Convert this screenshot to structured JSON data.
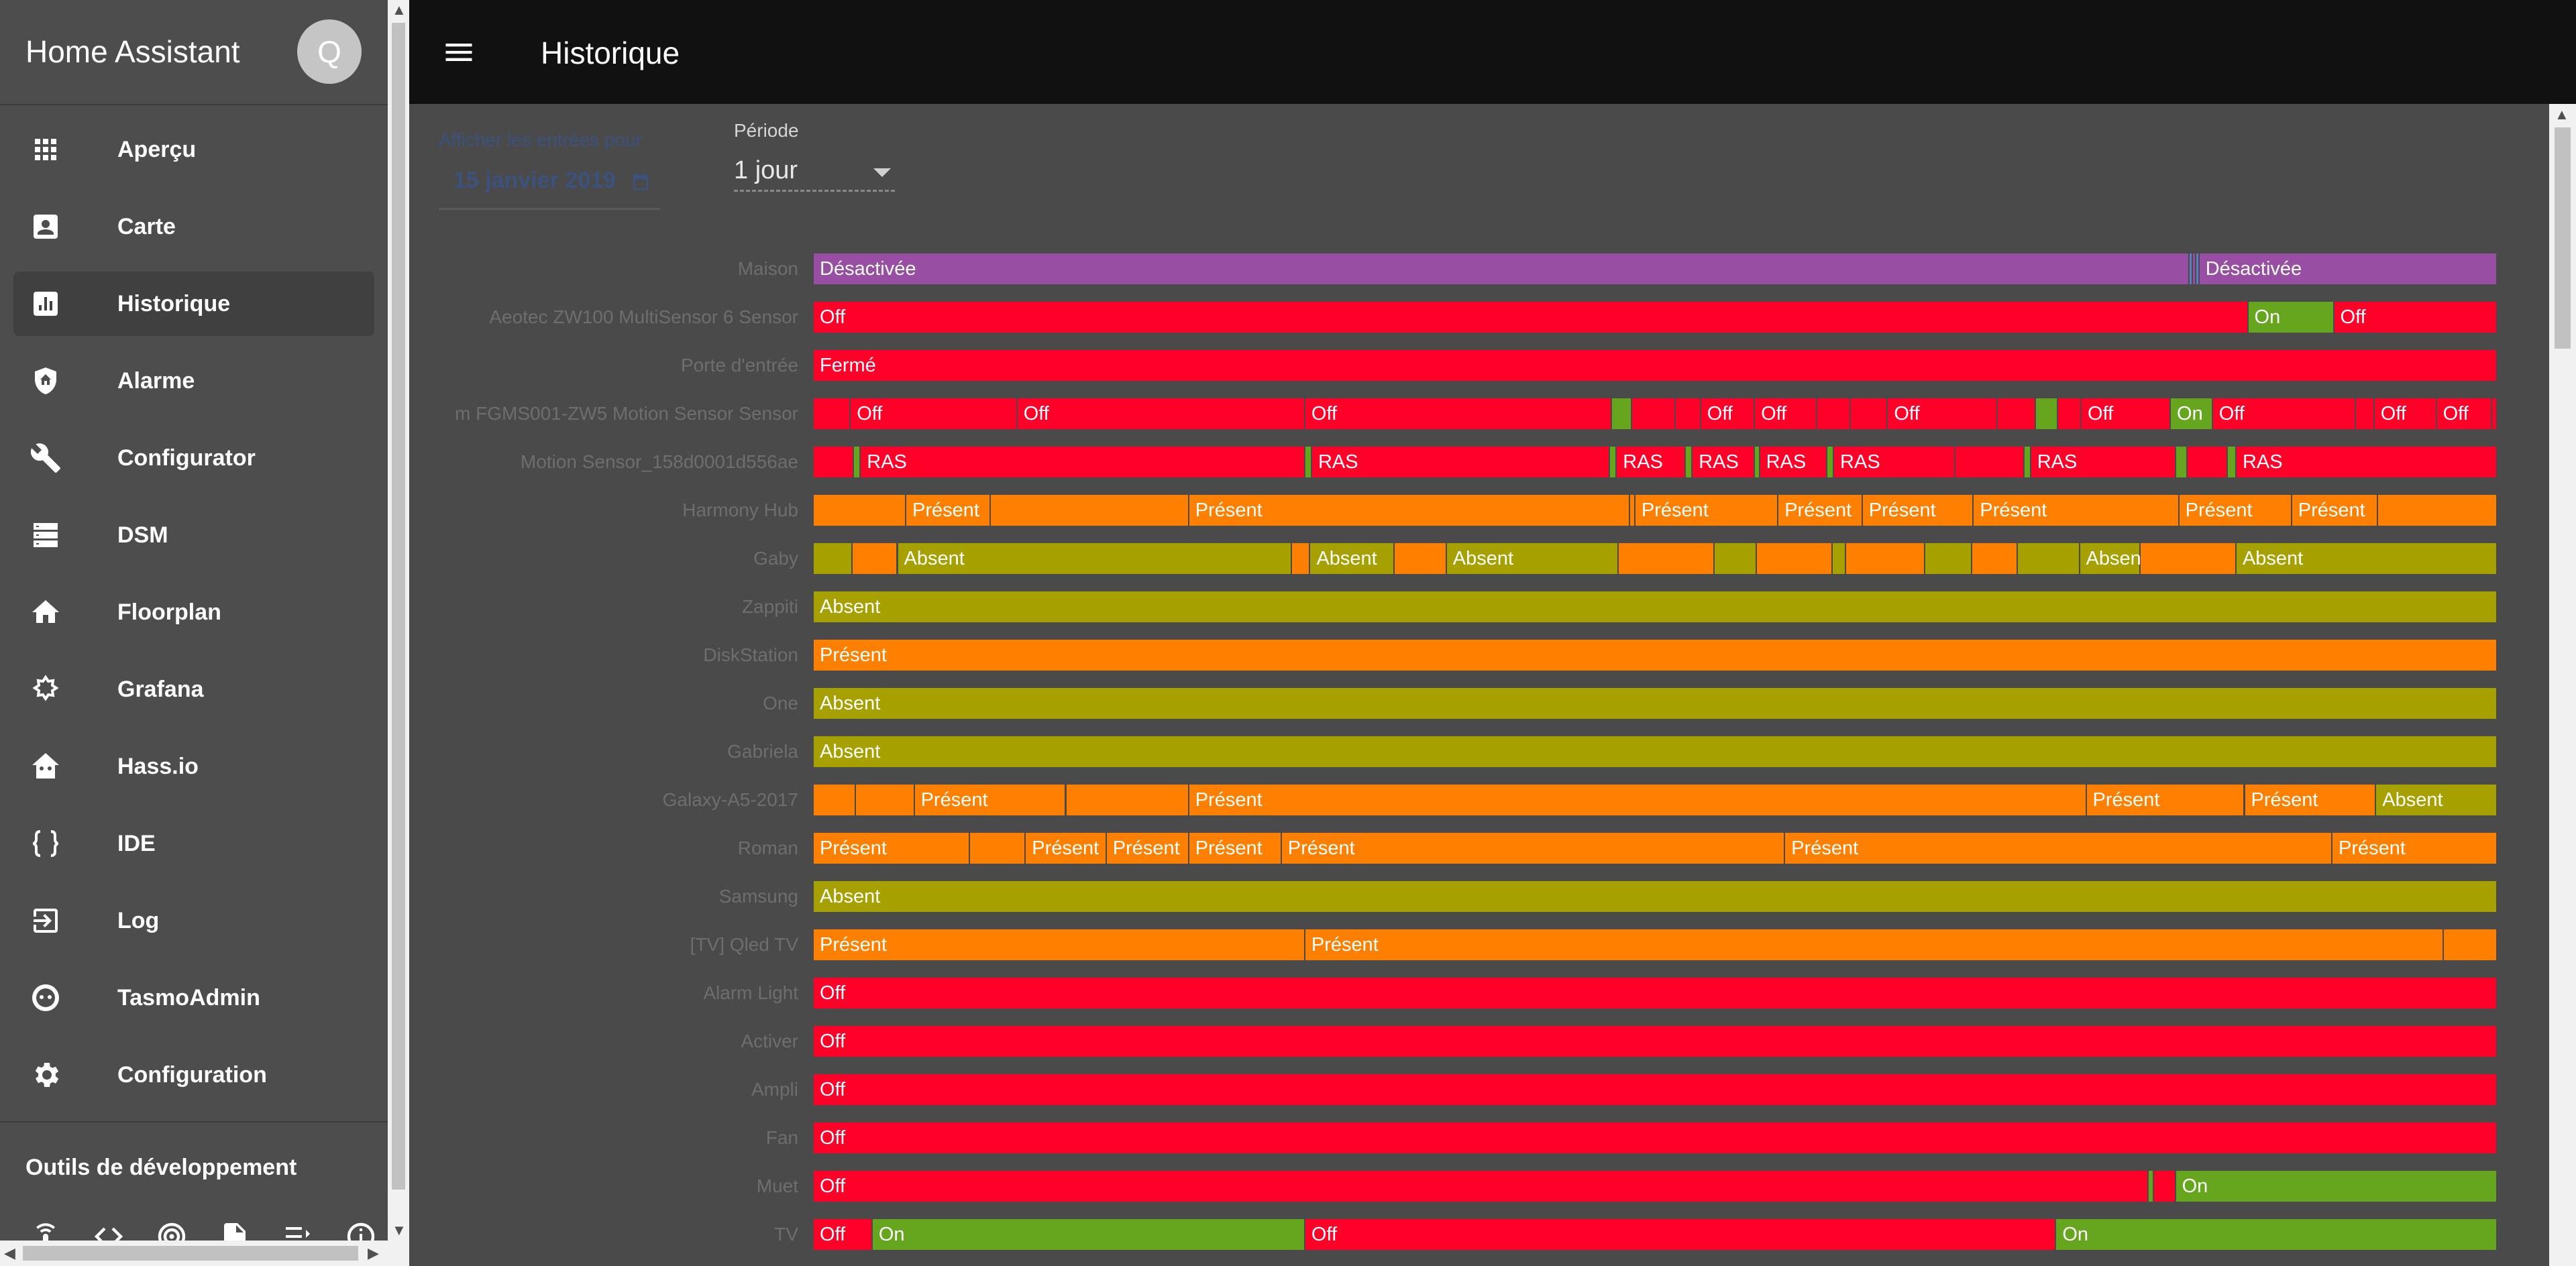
{
  "app": {
    "title": "Home Assistant",
    "avatar_initial": "Q"
  },
  "sidebar": {
    "items": [
      {
        "label": "Aperçu",
        "icon": "apps-grid-icon"
      },
      {
        "label": "Carte",
        "icon": "account-box-icon"
      },
      {
        "label": "Historique",
        "icon": "bar-chart-icon",
        "active": true
      },
      {
        "label": "Alarme",
        "icon": "shield-home-icon"
      },
      {
        "label": "Configurator",
        "icon": "wrench-icon"
      },
      {
        "label": "DSM",
        "icon": "server-icon"
      },
      {
        "label": "Floorplan",
        "icon": "home-icon"
      },
      {
        "label": "Grafana",
        "icon": "grafana-icon"
      },
      {
        "label": "Hass.io",
        "icon": "hassio-icon"
      },
      {
        "label": "IDE",
        "icon": "code-braces-icon"
      },
      {
        "label": "Log",
        "icon": "login-icon"
      },
      {
        "label": "TasmoAdmin",
        "icon": "tasmota-icon"
      },
      {
        "label": "Configuration",
        "icon": "gear-icon"
      }
    ],
    "dev_tools_title": "Outils de développement",
    "dev_tools": [
      "remote-icon",
      "code-tags-icon",
      "radio-tower-icon",
      "file-code-icon",
      "format-list-icon",
      "info-icon"
    ]
  },
  "header": {
    "title": "Historique"
  },
  "filters": {
    "date_label": "Afficher les entrées pour",
    "date_value": "15 janvier 2019",
    "period_label": "Période",
    "period_value": "1 jour"
  },
  "colors": {
    "off": "#ff0029",
    "on": "#66a61e",
    "present": "#ff7f00",
    "absent": "#a6a000",
    "maison": "#984ea3"
  },
  "timeline": [
    {
      "label": "Maison",
      "segments": [
        {
          "s": 0,
          "e": 81.7,
          "c": "maison",
          "t": "Désactivée"
        },
        {
          "s": 81.7,
          "e": 81.9,
          "c": "#5b7fc7"
        },
        {
          "s": 81.9,
          "e": 82.1,
          "c": "maison"
        },
        {
          "s": 82.1,
          "e": 82.3,
          "c": "#5b7fc7"
        },
        {
          "s": 82.3,
          "e": 100,
          "c": "maison",
          "t": "Désactivée"
        }
      ]
    },
    {
      "label": "Aeotec ZW100 MultiSensor 6 Sensor",
      "segments": [
        {
          "s": 0,
          "e": 85.2,
          "c": "off",
          "t": "Off"
        },
        {
          "s": 85.2,
          "e": 90.3,
          "c": "on",
          "t": "On"
        },
        {
          "s": 90.3,
          "e": 100,
          "c": "off",
          "t": "Off"
        }
      ]
    },
    {
      "label": "Porte d'entrée",
      "segments": [
        {
          "s": 0,
          "e": 100,
          "c": "off",
          "t": "Fermé"
        }
      ]
    },
    {
      "label": "m FGMS001-ZW5 Motion Sensor Sensor",
      "segments": [
        {
          "s": 0,
          "e": 2.2,
          "c": "off"
        },
        {
          "s": 2.2,
          "e": 12.1,
          "c": "off",
          "t": "Off"
        },
        {
          "s": 12.1,
          "e": 29.2,
          "c": "off",
          "t": "Off"
        },
        {
          "s": 29.2,
          "e": 47.4,
          "c": "off",
          "t": "Off"
        },
        {
          "s": 47.4,
          "e": 48.6,
          "c": "on"
        },
        {
          "s": 48.6,
          "e": 51.2,
          "c": "off"
        },
        {
          "s": 51.2,
          "e": 52.7,
          "c": "off"
        },
        {
          "s": 52.7,
          "e": 55.9,
          "c": "off",
          "t": "Off"
        },
        {
          "s": 55.9,
          "e": 59.6,
          "c": "off",
          "t": "Off"
        },
        {
          "s": 59.6,
          "e": 61.6,
          "c": "off"
        },
        {
          "s": 61.6,
          "e": 63.8,
          "c": "off"
        },
        {
          "s": 63.8,
          "e": 70.3,
          "c": "off",
          "t": "Off"
        },
        {
          "s": 70.3,
          "e": 72.6,
          "c": "off"
        },
        {
          "s": 72.6,
          "e": 73.9,
          "c": "on"
        },
        {
          "s": 73.9,
          "e": 75.3,
          "c": "off"
        },
        {
          "s": 75.3,
          "e": 80.6,
          "c": "off",
          "t": "Off"
        },
        {
          "s": 80.6,
          "e": 83.1,
          "c": "on",
          "t": "On"
        },
        {
          "s": 83.1,
          "e": 91.6,
          "c": "off",
          "t": "Off"
        },
        {
          "s": 91.6,
          "e": 92.7,
          "c": "off"
        },
        {
          "s": 92.7,
          "e": 96.4,
          "c": "off",
          "t": "Off"
        },
        {
          "s": 96.4,
          "e": 99.7,
          "c": "off",
          "t": "Off"
        },
        {
          "s": 99.7,
          "e": 100,
          "c": "off"
        }
      ]
    },
    {
      "label": "Motion Sensor_158d0001d556ae",
      "segments": [
        {
          "s": 0,
          "e": 2.4,
          "c": "off"
        },
        {
          "s": 2.4,
          "e": 2.8,
          "c": "on"
        },
        {
          "s": 2.8,
          "e": 29.2,
          "c": "off",
          "t": "RAS"
        },
        {
          "s": 29.2,
          "e": 29.6,
          "c": "on"
        },
        {
          "s": 29.6,
          "e": 47.3,
          "c": "off",
          "t": "RAS"
        },
        {
          "s": 47.3,
          "e": 47.7,
          "c": "on"
        },
        {
          "s": 47.7,
          "e": 51.8,
          "c": "off",
          "t": "RAS"
        },
        {
          "s": 51.8,
          "e": 52.2,
          "c": "on"
        },
        {
          "s": 52.2,
          "e": 55.9,
          "c": "off",
          "t": "RAS"
        },
        {
          "s": 55.9,
          "e": 56.2,
          "c": "on"
        },
        {
          "s": 56.2,
          "e": 60.2,
          "c": "off",
          "t": "RAS"
        },
        {
          "s": 60.2,
          "e": 60.6,
          "c": "on"
        },
        {
          "s": 60.6,
          "e": 67.8,
          "c": "off",
          "t": "RAS"
        },
        {
          "s": 67.8,
          "e": 71.9,
          "c": "off"
        },
        {
          "s": 71.9,
          "e": 72.3,
          "c": "on"
        },
        {
          "s": 72.3,
          "e": 80.9,
          "c": "off",
          "t": "RAS"
        },
        {
          "s": 80.9,
          "e": 81.6,
          "c": "on"
        },
        {
          "s": 81.6,
          "e": 84.0,
          "c": "off"
        },
        {
          "s": 84.0,
          "e": 84.5,
          "c": "on"
        },
        {
          "s": 84.5,
          "e": 100,
          "c": "off",
          "t": "RAS"
        }
      ]
    },
    {
      "label": "Harmony Hub",
      "segments": [
        {
          "s": 0,
          "e": 5.5,
          "c": "present"
        },
        {
          "s": 5.5,
          "e": 10.5,
          "c": "present",
          "t": "Présent"
        },
        {
          "s": 10.5,
          "e": 22.3,
          "c": "present"
        },
        {
          "s": 22.3,
          "e": 48.5,
          "c": "present",
          "t": "Présent"
        },
        {
          "s": 48.5,
          "e": 48.8,
          "c": "present"
        },
        {
          "s": 48.8,
          "e": 57.3,
          "c": "present",
          "t": "Présent"
        },
        {
          "s": 57.3,
          "e": 62.3,
          "c": "present",
          "t": "Présent"
        },
        {
          "s": 62.3,
          "e": 68.9,
          "c": "present",
          "t": "Présent"
        },
        {
          "s": 68.9,
          "e": 81.1,
          "c": "present",
          "t": "Présent"
        },
        {
          "s": 81.1,
          "e": 87.8,
          "c": "present",
          "t": "Présent"
        },
        {
          "s": 87.8,
          "e": 92.9,
          "c": "present",
          "t": "Présent"
        },
        {
          "s": 92.9,
          "e": 100,
          "c": "present"
        }
      ]
    },
    {
      "label": "Gaby",
      "segments": [
        {
          "s": 0,
          "e": 2.3,
          "c": "absent"
        },
        {
          "s": 2.3,
          "e": 5.0,
          "c": "present"
        },
        {
          "s": 5.0,
          "e": 28.4,
          "c": "absent",
          "t": "Absent"
        },
        {
          "s": 28.4,
          "e": 29.5,
          "c": "present"
        },
        {
          "s": 29.5,
          "e": 34.5,
          "c": "absent",
          "t": "Absent"
        },
        {
          "s": 34.5,
          "e": 37.6,
          "c": "present"
        },
        {
          "s": 37.6,
          "e": 47.8,
          "c": "absent",
          "t": "Absent"
        },
        {
          "s": 47.8,
          "e": 53.5,
          "c": "present"
        },
        {
          "s": 53.5,
          "e": 56.0,
          "c": "absent"
        },
        {
          "s": 56.0,
          "e": 60.5,
          "c": "present"
        },
        {
          "s": 60.5,
          "e": 61.3,
          "c": "absent"
        },
        {
          "s": 61.3,
          "e": 66.0,
          "c": "present"
        },
        {
          "s": 66.0,
          "e": 68.8,
          "c": "absent"
        },
        {
          "s": 68.8,
          "e": 71.5,
          "c": "present"
        },
        {
          "s": 71.5,
          "e": 75.2,
          "c": "absent"
        },
        {
          "s": 75.2,
          "e": 78.8,
          "c": "absent",
          "t": "Absent"
        },
        {
          "s": 78.8,
          "e": 84.5,
          "c": "present"
        },
        {
          "s": 84.5,
          "e": 100,
          "c": "absent",
          "t": "Absent"
        }
      ]
    },
    {
      "label": "Zappiti",
      "segments": [
        {
          "s": 0,
          "e": 100,
          "c": "absent",
          "t": "Absent"
        }
      ]
    },
    {
      "label": "DiskStation",
      "segments": [
        {
          "s": 0,
          "e": 100,
          "c": "present",
          "t": "Présent"
        }
      ]
    },
    {
      "label": "One",
      "segments": [
        {
          "s": 0,
          "e": 100,
          "c": "absent",
          "t": "Absent"
        }
      ]
    },
    {
      "label": "Gabriela",
      "segments": [
        {
          "s": 0,
          "e": 100,
          "c": "absent",
          "t": "Absent"
        }
      ]
    },
    {
      "label": "Galaxy-A5-2017",
      "segments": [
        {
          "s": 0,
          "e": 2.5,
          "c": "present"
        },
        {
          "s": 2.5,
          "e": 6.0,
          "c": "present"
        },
        {
          "s": 6.0,
          "e": 15.0,
          "c": "present",
          "t": "Présent"
        },
        {
          "s": 15.0,
          "e": 22.3,
          "c": "present"
        },
        {
          "s": 22.3,
          "e": 75.6,
          "c": "present",
          "t": "Présent"
        },
        {
          "s": 75.6,
          "e": 85.0,
          "c": "present",
          "t": "Présent"
        },
        {
          "s": 85.0,
          "e": 92.8,
          "c": "present",
          "t": "Présent"
        },
        {
          "s": 92.8,
          "e": 100,
          "c": "absent",
          "t": "Absent"
        }
      ]
    },
    {
      "label": "Roman",
      "segments": [
        {
          "s": 0,
          "e": 9.3,
          "c": "present",
          "t": "Présent"
        },
        {
          "s": 9.3,
          "e": 12.6,
          "c": "present"
        },
        {
          "s": 12.6,
          "e": 17.4,
          "c": "present",
          "t": "Présent"
        },
        {
          "s": 17.4,
          "e": 22.3,
          "c": "present",
          "t": "Présent"
        },
        {
          "s": 22.3,
          "e": 27.8,
          "c": "present",
          "t": "Présent"
        },
        {
          "s": 27.8,
          "e": 57.7,
          "c": "present",
          "t": "Présent"
        },
        {
          "s": 57.7,
          "e": 90.2,
          "c": "present",
          "t": "Présent"
        },
        {
          "s": 90.2,
          "e": 100,
          "c": "present",
          "t": "Présent"
        }
      ]
    },
    {
      "label": "Samsung",
      "segments": [
        {
          "s": 0,
          "e": 100,
          "c": "absent",
          "t": "Absent"
        }
      ]
    },
    {
      "label": "[TV] Qled TV",
      "segments": [
        {
          "s": 0,
          "e": 29.2,
          "c": "present",
          "t": "Présent"
        },
        {
          "s": 29.2,
          "e": 96.8,
          "c": "present",
          "t": "Présent"
        },
        {
          "s": 96.8,
          "e": 100,
          "c": "present"
        }
      ]
    },
    {
      "label": "Alarm Light",
      "segments": [
        {
          "s": 0,
          "e": 100,
          "c": "off",
          "t": "Off"
        }
      ]
    },
    {
      "label": "Activer",
      "segments": [
        {
          "s": 0,
          "e": 100,
          "c": "off",
          "t": "Off"
        }
      ]
    },
    {
      "label": "Ampli",
      "segments": [
        {
          "s": 0,
          "e": 100,
          "c": "off",
          "t": "Off"
        }
      ]
    },
    {
      "label": "Fan",
      "segments": [
        {
          "s": 0,
          "e": 100,
          "c": "off",
          "t": "Off"
        }
      ]
    },
    {
      "label": "Muet",
      "segments": [
        {
          "s": 0,
          "e": 79.3,
          "c": "off",
          "t": "Off"
        },
        {
          "s": 79.3,
          "e": 79.6,
          "c": "on"
        },
        {
          "s": 79.6,
          "e": 80.9,
          "c": "off"
        },
        {
          "s": 80.9,
          "e": 100,
          "c": "on",
          "t": "On"
        }
      ]
    },
    {
      "label": "TV",
      "segments": [
        {
          "s": 0,
          "e": 3.5,
          "c": "off",
          "t": "Off"
        },
        {
          "s": 3.5,
          "e": 29.2,
          "c": "on",
          "t": "On"
        },
        {
          "s": 29.2,
          "e": 73.8,
          "c": "off",
          "t": "Off"
        },
        {
          "s": 73.8,
          "e": 100,
          "c": "on",
          "t": "On"
        }
      ]
    }
  ]
}
